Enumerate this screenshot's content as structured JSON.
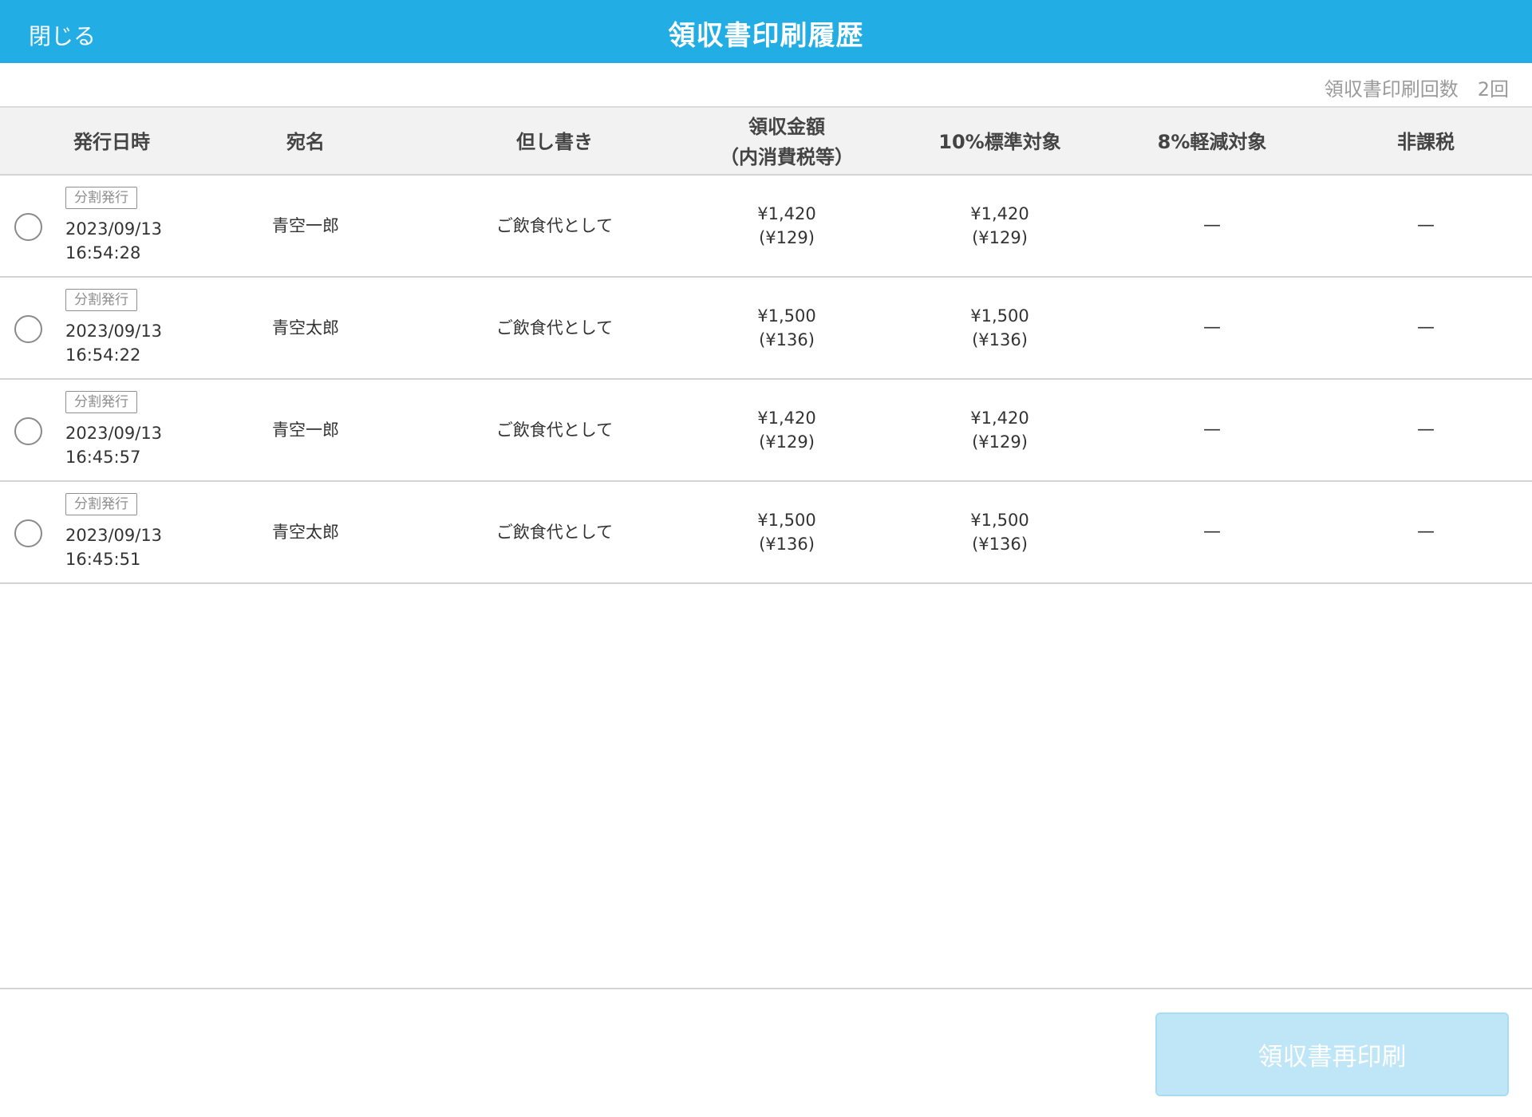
{
  "header": {
    "close_label": "閉じる",
    "title": "領収書印刷履歴"
  },
  "summary": {
    "count_label": "領収書印刷回数",
    "count_value": "2回"
  },
  "table": {
    "columns": {
      "issued_at": "発行日時",
      "recipient": "宛名",
      "memo": "但し書き",
      "amount_line1": "領収金額",
      "amount_line2": "（内消費税等）",
      "standard": "10%標準対象",
      "reduced": "8%軽減対象",
      "non_taxable": "非課税"
    },
    "rows": [
      {
        "badge": "分割発行",
        "date": "2023/09/13",
        "time": "16:54:28",
        "recipient": "青空一郎",
        "memo": "ご飲食代として",
        "amount": "¥1,420",
        "amount_tax": "(¥129)",
        "standard": "¥1,420",
        "standard_tax": "(¥129)",
        "reduced": "—",
        "non_taxable": "—"
      },
      {
        "badge": "分割発行",
        "date": "2023/09/13",
        "time": "16:54:22",
        "recipient": "青空太郎",
        "memo": "ご飲食代として",
        "amount": "¥1,500",
        "amount_tax": "(¥136)",
        "standard": "¥1,500",
        "standard_tax": "(¥136)",
        "reduced": "—",
        "non_taxable": "—"
      },
      {
        "badge": "分割発行",
        "date": "2023/09/13",
        "time": "16:45:57",
        "recipient": "青空一郎",
        "memo": "ご飲食代として",
        "amount": "¥1,420",
        "amount_tax": "(¥129)",
        "standard": "¥1,420",
        "standard_tax": "(¥129)",
        "reduced": "—",
        "non_taxable": "—"
      },
      {
        "badge": "分割発行",
        "date": "2023/09/13",
        "time": "16:45:51",
        "recipient": "青空太郎",
        "memo": "ご飲食代として",
        "amount": "¥1,500",
        "amount_tax": "(¥136)",
        "standard": "¥1,500",
        "standard_tax": "(¥136)",
        "reduced": "—",
        "non_taxable": "—"
      }
    ]
  },
  "footer": {
    "reprint_label": "領収書再印刷"
  },
  "colors": {
    "header_bg": "#22aee5",
    "button_disabled_bg": "#bfe6f7"
  }
}
